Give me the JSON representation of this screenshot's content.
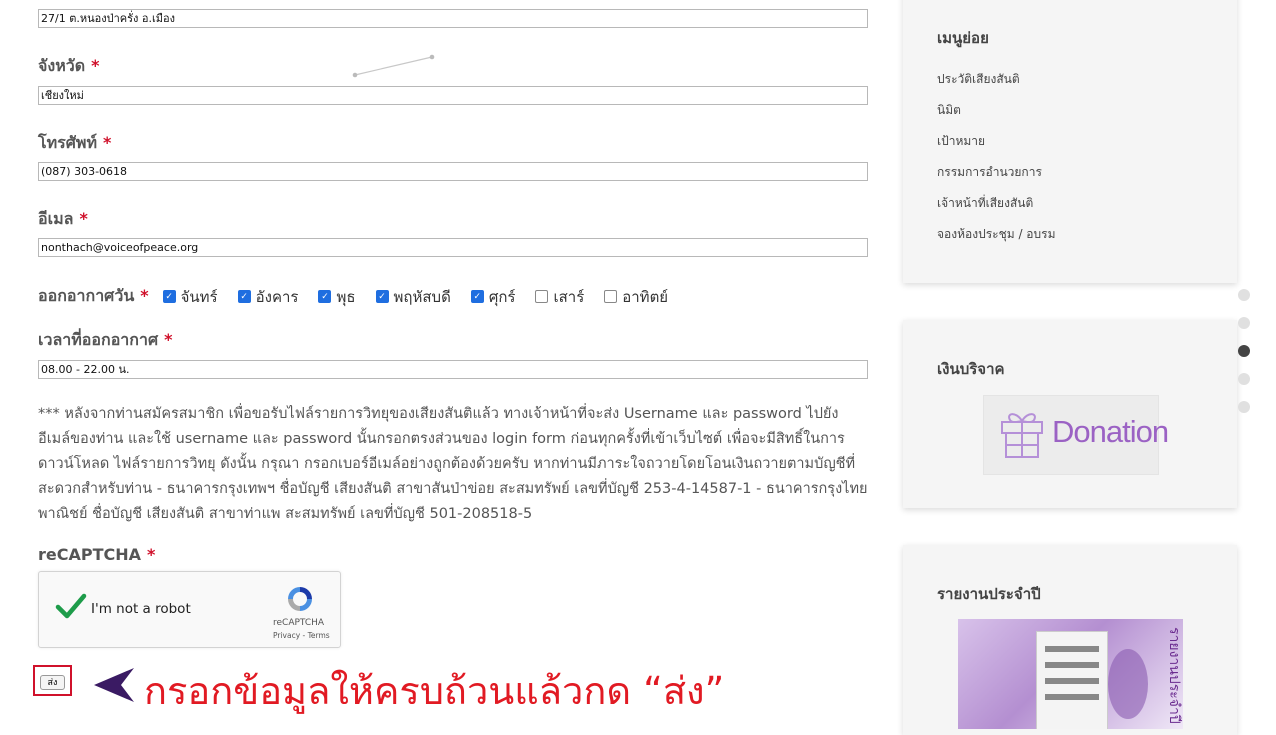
{
  "form": {
    "address_value": "27/1 ต.หนองป่าครั่ง อ.เมือง",
    "province": {
      "label": "จังหวัด",
      "value": "เชียงใหม่"
    },
    "phone": {
      "label": "โทรศัพท์",
      "value": "(087) 303-0618"
    },
    "email": {
      "label": "อีเมล",
      "value": "nonthach@voiceofpeace.org"
    },
    "broadcast_days": {
      "label": "ออกอากาศวัน",
      "days": [
        {
          "label": "จันทร์",
          "checked": true
        },
        {
          "label": "อังคาร",
          "checked": true
        },
        {
          "label": "พุธ",
          "checked": true
        },
        {
          "label": "พฤหัสบดี",
          "checked": true
        },
        {
          "label": "ศุกร์",
          "checked": true
        },
        {
          "label": "เสาร์",
          "checked": false
        },
        {
          "label": "อาทิตย์",
          "checked": false
        }
      ]
    },
    "broadcast_time": {
      "label": "เวลาที่ออกอากาศ",
      "value": "08.00 - 22.00 น."
    },
    "required_mark": "*",
    "note": "*** หลังจากท่านสมัครสมาชิก เพื่อขอรับไฟล์รายการวิทยุของเสียงสันติแล้ว ทางเจ้าหน้าที่จะส่ง Username และ password ไปยังอีเมล์ของท่าน และใช้ username และ password นั้นกรอกตรงส่วนของ login form ก่อนทุกครั้งที่เข้าเว็บไซต์ เพื่อจะมีสิทธิ์ในการดาวน์โหลด ไฟล์รายการวิทยุ ดังนั้น กรุณา กรอกเบอร์อีเมล์อย่างถูกต้องด้วยครับ หากท่านมีภาระใจถวายโดยโอนเงินถวายตามบัญชีที่สะดวกสำหรับท่าน - ธนาคารกรุงเทพฯ ชื่อบัญชี เสียงสันติ สาขาสันป่าข่อย สะสมทรัพย์ เลขที่บัญชี 253-4-14587-1 - ธนาคารกรุงไทยพาณิชย์ ชื่อบัญชี เสียงสันติ สาขาท่าแพ สะสมทรัพย์ เลขที่บัญชี 501-208518-5",
    "recaptcha": {
      "label": "reCAPTCHA",
      "checkbox_text": "I'm not a robot",
      "brand": "reCAPTCHA",
      "links": "Privacy - Terms"
    },
    "submit_label": "ส่ง",
    "instruction": "กรอกข้อมูลให้ครบถ้วนแล้วกด “ส่ง”"
  },
  "sidebar": {
    "submenu": {
      "title": "เมนูย่อย",
      "items": [
        "ประวัติเสียงสันติ",
        "นิมิต",
        "เป้าหมาย",
        "กรรมการอำนวยการ",
        "เจ้าหน้าที่เสียงสันติ",
        "จองห้องประชุม / อบรม"
      ]
    },
    "donation": {
      "title": "เงินบริจาค",
      "button_text": "Donation"
    },
    "annual_report": {
      "title": "รายงานประจำปี",
      "cover_text": "รายงานประจำปี"
    }
  },
  "colors": {
    "accent_red": "#e11a23",
    "checkbox_blue": "#1f6ee0",
    "donation_purple": "#9b62c4"
  },
  "carousel": {
    "dot_count": 5,
    "active_index": 2
  }
}
